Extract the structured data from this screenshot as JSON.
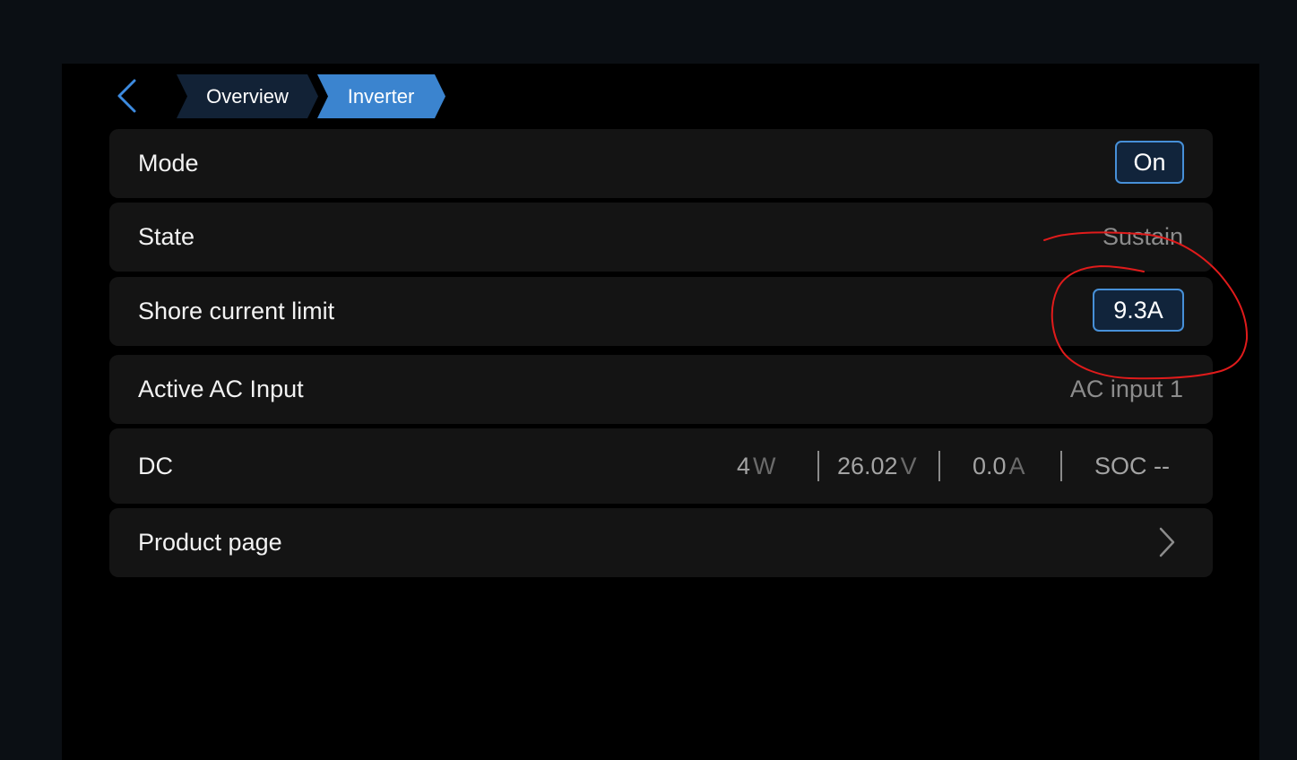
{
  "nav": {
    "back_icon": "chevron-left-icon",
    "breadcrumb": [
      {
        "label": "Overview",
        "active": false
      },
      {
        "label": "Inverter",
        "active": true
      }
    ]
  },
  "rows": {
    "mode": {
      "label": "Mode",
      "value": "On"
    },
    "state": {
      "label": "State",
      "value": "Sustain"
    },
    "shore_current_limit": {
      "label": "Shore current limit",
      "value": "9.3A"
    },
    "active_ac_input": {
      "label": "Active AC Input",
      "value": "AC input 1"
    },
    "dc": {
      "label": "DC",
      "power": {
        "value": "4",
        "unit": "W"
      },
      "voltage": {
        "value": "26.02",
        "unit": "V"
      },
      "current": {
        "value": "0.0",
        "unit": "A"
      },
      "soc": "SOC --"
    },
    "product_page": {
      "label": "Product page",
      "icon": "chevron-right-icon"
    }
  },
  "colors": {
    "background": "#000000",
    "row_background": "#141414",
    "accent": "#4790d8",
    "breadcrumb_inactive": "#122236",
    "breadcrumb_active": "#3b84cf",
    "annotation_ink": "#e01b1b"
  }
}
